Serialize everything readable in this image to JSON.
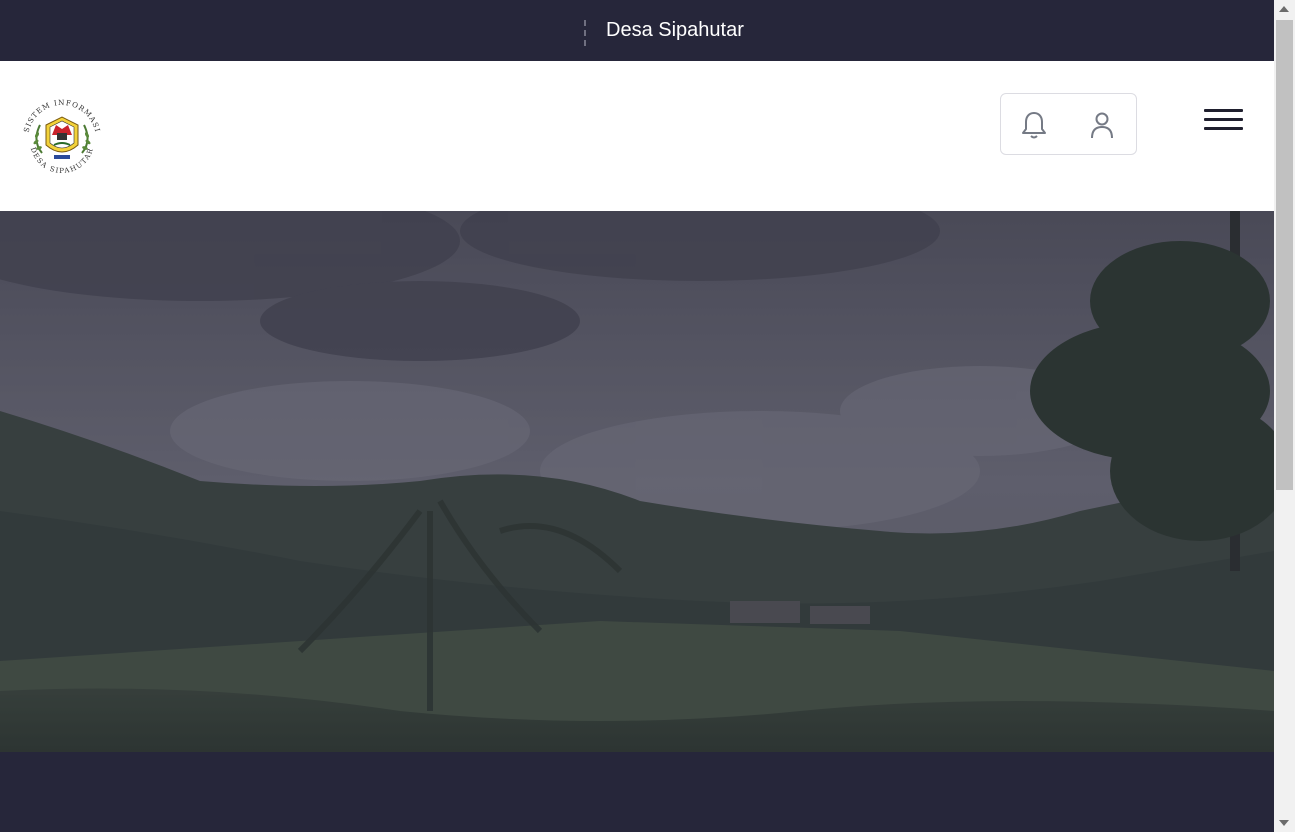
{
  "topbar": {
    "site_name": "Desa Sipahutar"
  },
  "header": {
    "logo": {
      "top_text": "SISTEM INFORMASI",
      "bottom_text": "DESA SIPAHUTAR",
      "icon": "village-emblem-icon"
    },
    "actions": [
      {
        "icon": "bell-icon"
      },
      {
        "icon": "user-icon"
      }
    ],
    "menu_icon": "hamburger-menu-icon"
  },
  "hero": {
    "image": "overcast-village-landscape",
    "overlay_color": "#2a2a3e"
  },
  "colors": {
    "dark_band": "#26263a",
    "header_bg": "#ffffff",
    "text_light": "#ffffff"
  }
}
